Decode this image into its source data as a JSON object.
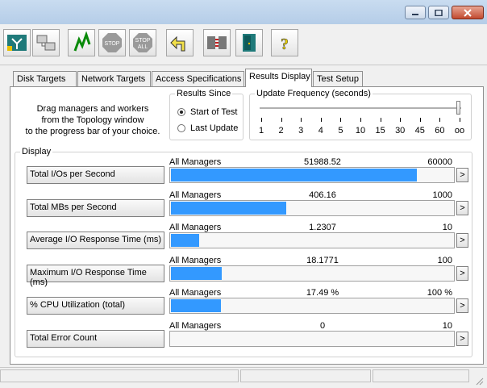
{
  "window": {
    "minimize_glyph": "—",
    "maximize_glyph": "□",
    "close_glyph": "✕"
  },
  "toolbar": {
    "buttons": [
      {
        "icon": "topology-icon"
      },
      {
        "icon": "workers-icon"
      },
      {
        "icon": "start-green-flag-icon"
      },
      {
        "icon": "stop-icon",
        "label": "STOP"
      },
      {
        "icon": "stop-all-icon",
        "label1": "STOP",
        "label2": "ALL"
      },
      {
        "icon": "reset-arrow-icon"
      },
      {
        "icon": "worker-configure-icon"
      },
      {
        "icon": "exit-door-icon"
      },
      {
        "icon": "help-icon",
        "label": "?"
      }
    ]
  },
  "tabs": [
    {
      "label": "Disk Targets"
    },
    {
      "label": "Network Targets"
    },
    {
      "label": "Access Specifications"
    },
    {
      "label": "Results Display",
      "active": true
    },
    {
      "label": "Test Setup"
    }
  ],
  "hint": {
    "line1": "Drag managers and workers",
    "line2": "from the Topology window",
    "line3": "to the progress bar of your choice."
  },
  "results_since": {
    "title": "Results Since",
    "options": [
      {
        "label": "Start of Test",
        "selected": true
      },
      {
        "label": "Last Update",
        "selected": false
      }
    ]
  },
  "update_frequency": {
    "title": "Update Frequency (seconds)",
    "ticks": [
      "1",
      "2",
      "3",
      "4",
      "5",
      "10",
      "15",
      "30",
      "45",
      "60",
      "oo"
    ],
    "selected": "oo"
  },
  "display": {
    "title": "Display",
    "rows": [
      {
        "button": "Total I/Os per Second",
        "source": "All Managers",
        "value": "51988.52",
        "max": "60000",
        "fill": 0.866
      },
      {
        "button": "Total MBs per Second",
        "source": "All Managers",
        "value": "406.16",
        "max": "1000",
        "fill": 0.406
      },
      {
        "button": "Average I/O Response Time (ms)",
        "source": "All Managers",
        "value": "1.2307",
        "max": "10",
        "fill": 0.1
      },
      {
        "button": "Maximum I/O Response Time (ms)",
        "source": "All Managers",
        "value": "18.1771",
        "max": "100",
        "fill": 0.18
      },
      {
        "button": "% CPU Utilization (total)",
        "source": "All Managers",
        "value": "17.49 %",
        "max": "100 %",
        "fill": 0.175
      },
      {
        "button": "Total Error Count",
        "source": "All Managers",
        "value": "0",
        "max": "10",
        "fill": 0
      }
    ],
    "more_label": ">"
  },
  "colors": {
    "bar": "#3399ff",
    "accent": "#3399ff"
  }
}
